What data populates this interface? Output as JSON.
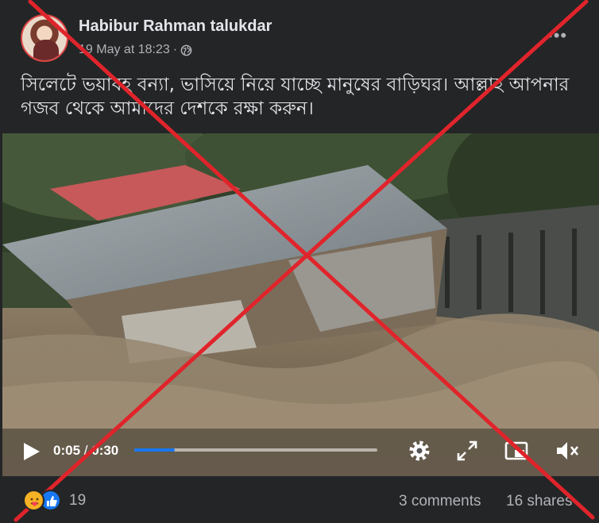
{
  "post": {
    "author": "Habibur Rahman talukdar",
    "date": "19 May at 18:23",
    "meta_separator": "·",
    "audience_icon": "globe-icon",
    "more_icon": "more-options-icon",
    "caption": "সিলেটে ভয়াবহ বন্যা, ভাসিয়ে নিয়ে যাচ্ছে মানুষের বাড়িঘর। আল্লাহ আপনার গজব থেকে আমাদের দেশকে রক্ষা করুন।"
  },
  "video": {
    "current_time": "0:05",
    "separator": "/",
    "duration": "0:30",
    "progress_fraction": 0.167,
    "controls": [
      "play-icon",
      "settings-gear-icon",
      "fullscreen-expand-icon",
      "picture-in-picture-icon",
      "mute-icon"
    ],
    "accent_color": "#1877f2"
  },
  "engagement": {
    "reaction_icons": [
      "care-reaction-icon",
      "like-reaction-icon"
    ],
    "reaction_count": "19",
    "comments": "3 comments",
    "shares": "16 shares"
  },
  "overlay": {
    "type": "red-cross-mark",
    "color": "#e0242b"
  }
}
